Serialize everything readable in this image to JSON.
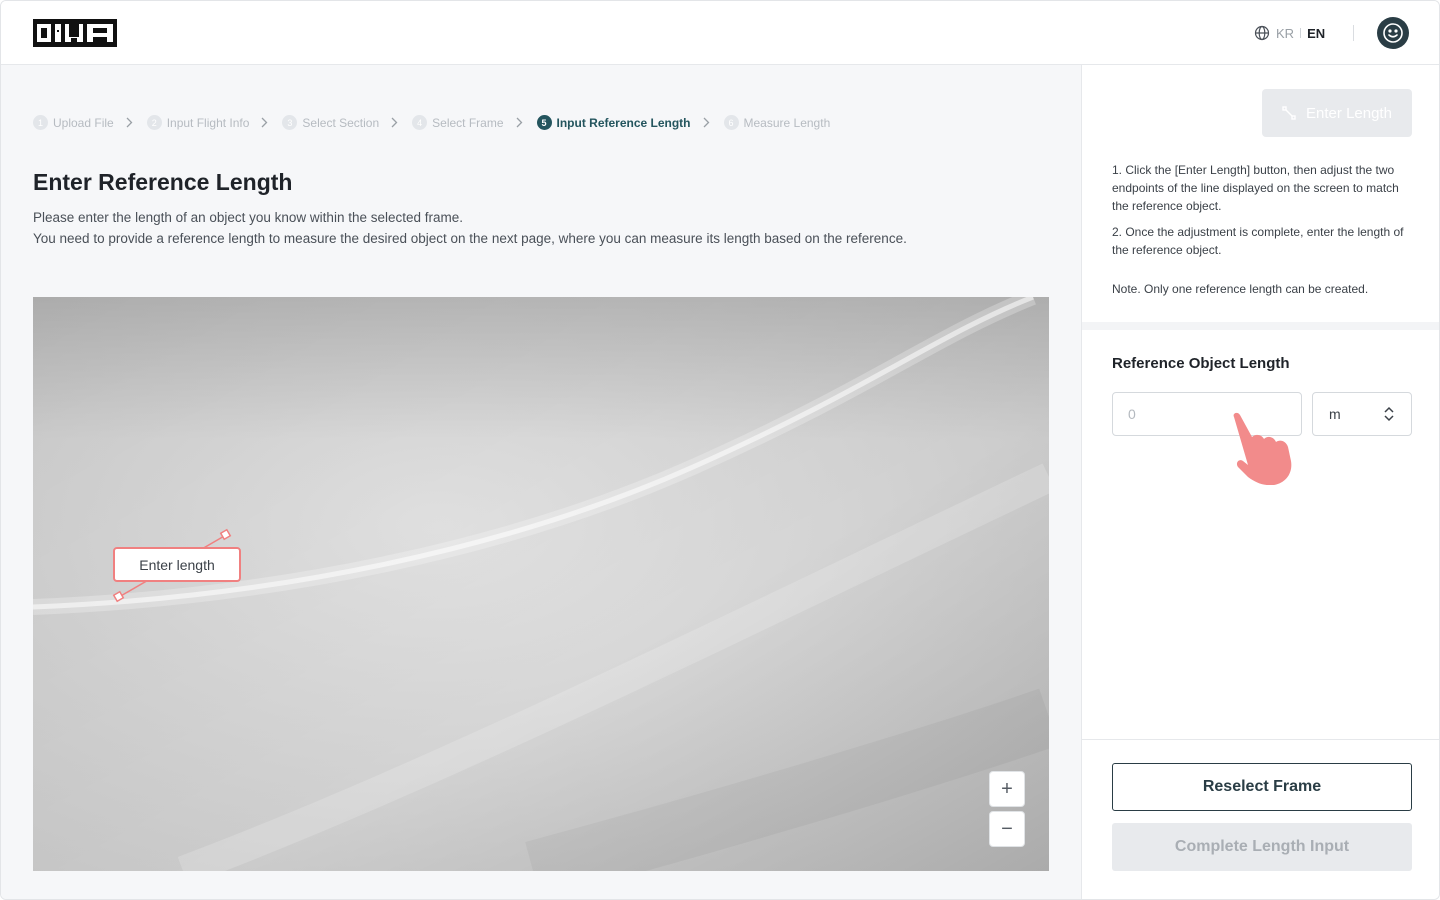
{
  "header": {
    "logo_text": "DIVA",
    "lang_kr": "KR",
    "lang_en": "EN"
  },
  "steps": [
    {
      "num": "1",
      "label": "Upload File"
    },
    {
      "num": "2",
      "label": "Input Flight Info"
    },
    {
      "num": "3",
      "label": "Select Section"
    },
    {
      "num": "4",
      "label": "Select Frame"
    },
    {
      "num": "5",
      "label": "Input Reference Length",
      "active": true
    },
    {
      "num": "6",
      "label": "Measure Length"
    }
  ],
  "main": {
    "title": "Enter Reference Length",
    "desc_line1": "Please enter the length of an object you know within the selected frame.",
    "desc_line2": "You need to provide a reference length to measure the desired object on the next page, where you can measure its length based on the reference.",
    "length_label": "Enter length",
    "zoom_in": "+",
    "zoom_out": "−"
  },
  "sidebar": {
    "enter_length_button": "Enter Length",
    "instr1": "1. Click the [Enter Length] button, then adjust the two endpoints of the line displayed on the screen to match the reference object.",
    "instr2": "2. Once the adjustment is complete, enter the length of the reference object.",
    "note": "Note. Only one reference length can be created.",
    "ref_title": "Reference Object Length",
    "ref_placeholder": "0",
    "unit_value": "m",
    "reselect_button": "Reselect Frame",
    "complete_button": "Complete Length Input"
  },
  "colors": {
    "accent": "#24555e",
    "dark": "#2a3d45",
    "annotation": "#f08080",
    "hand": "#f28b8b"
  }
}
